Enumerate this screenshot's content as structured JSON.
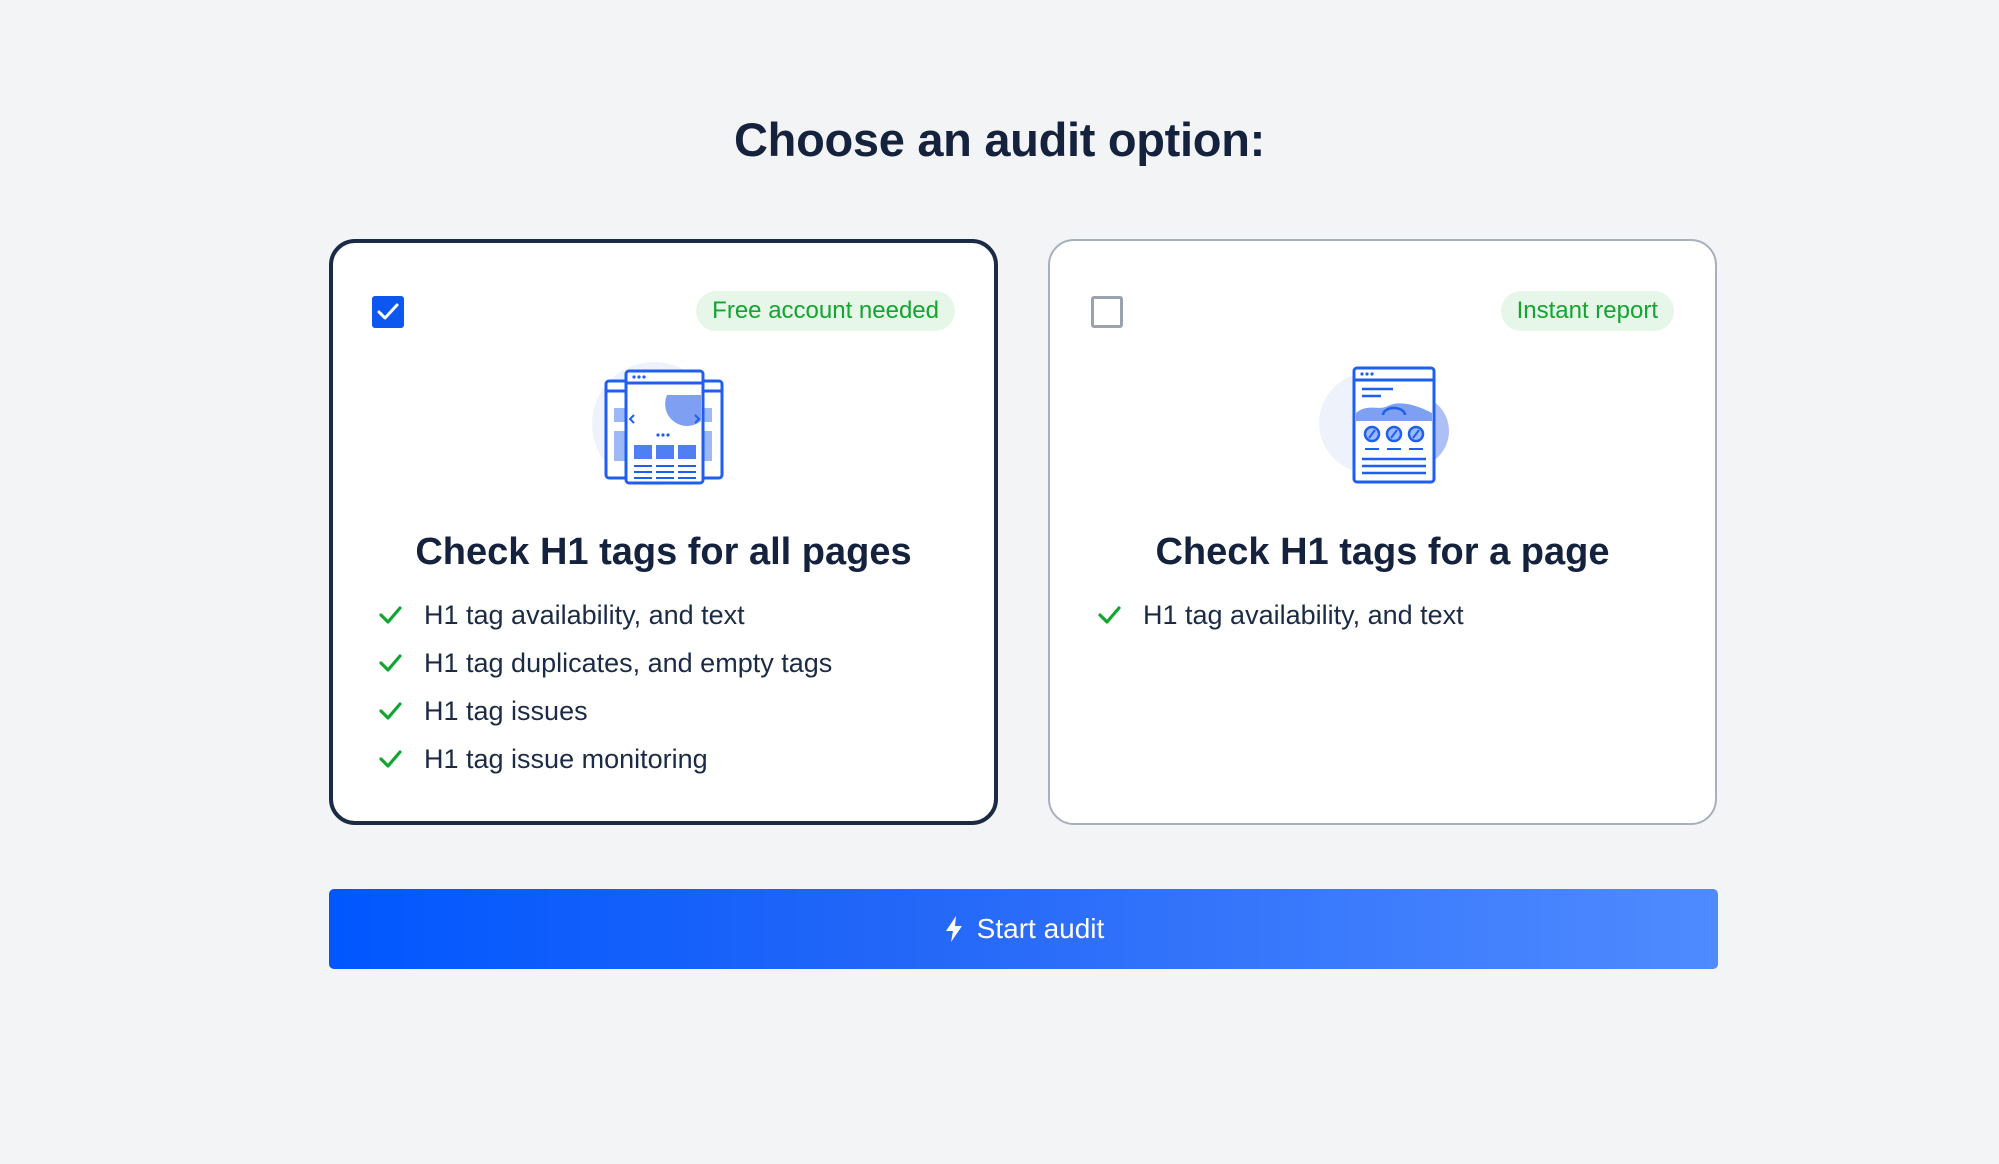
{
  "page": {
    "title": "Choose an audit option:"
  },
  "options": [
    {
      "selected": true,
      "badge": "Free account needed",
      "title": "Check H1 tags for all pages",
      "features": [
        "H1 tag availability, and text",
        "H1 tag duplicates, and empty tags",
        "H1 tag issues",
        "H1 tag issue monitoring"
      ],
      "icon": "multi-page-icon"
    },
    {
      "selected": false,
      "badge": "Instant report",
      "title": "Check H1 tags for a page",
      "features": [
        "H1 tag availability, and text"
      ],
      "icon": "single-page-icon"
    }
  ],
  "action": {
    "label": "Start audit",
    "icon": "lightning-bolt-icon"
  },
  "colors": {
    "background": "#f3f4f6",
    "primary": "#0b57f0",
    "badge_bg": "#e6f7ea",
    "badge_text": "#12a52f",
    "check_green": "#12a52f",
    "title_text": "#14223d"
  }
}
